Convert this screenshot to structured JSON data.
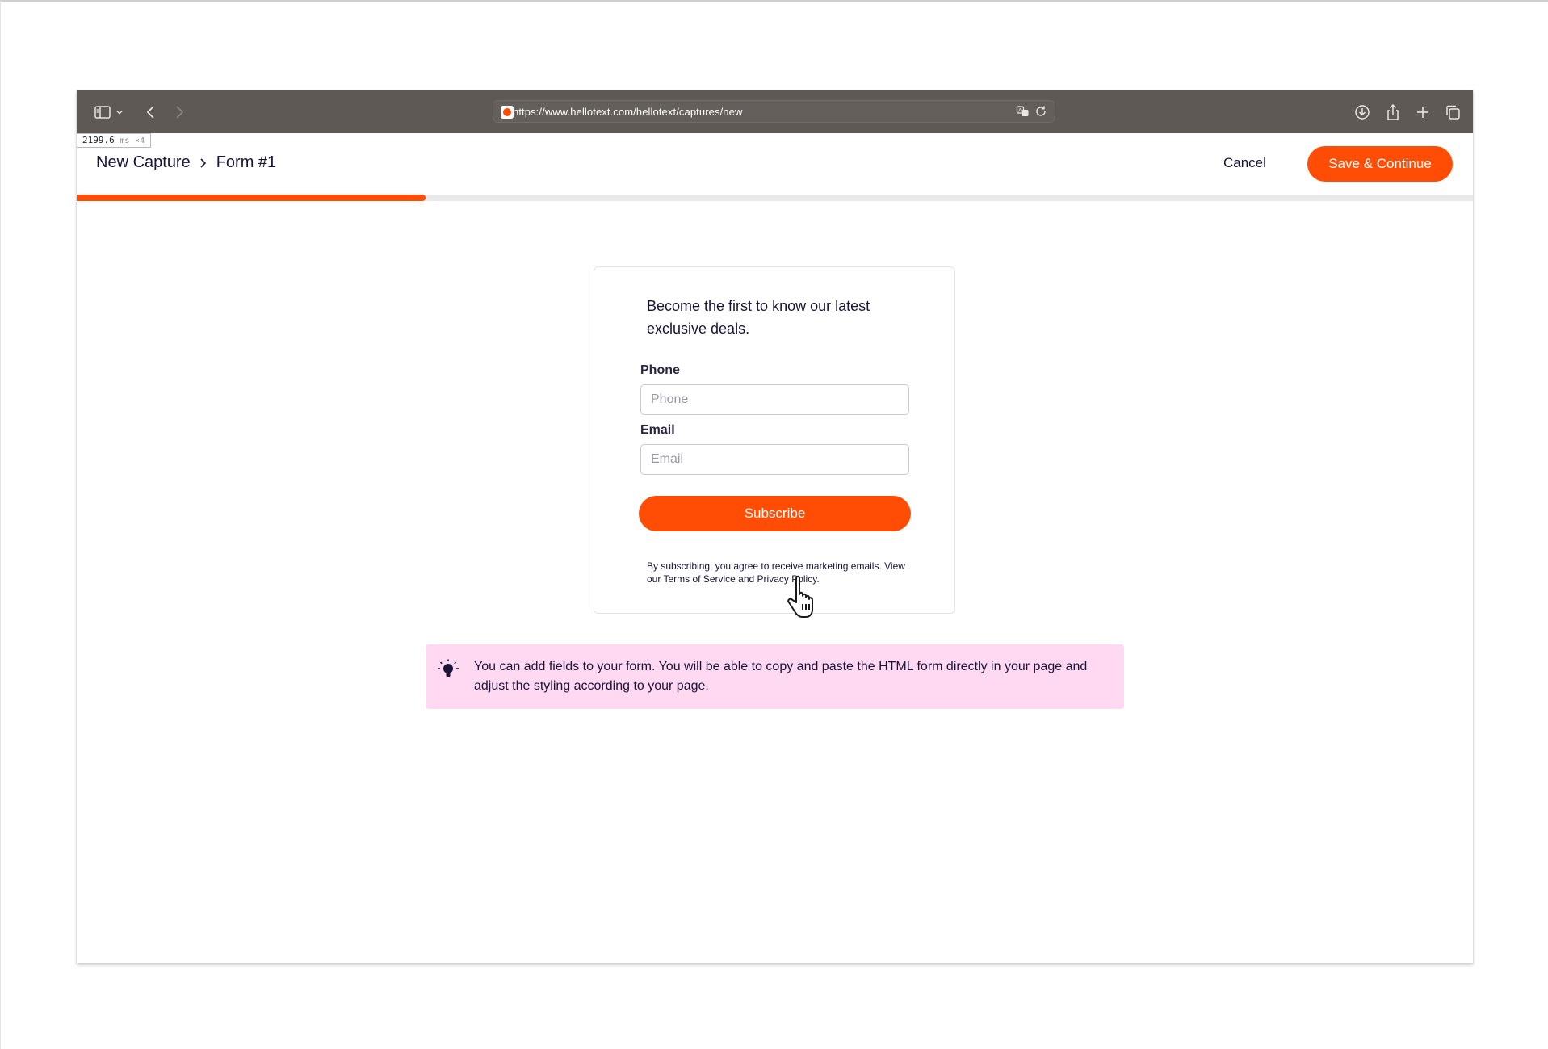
{
  "browser": {
    "url": "https://www.hellotext.com/hellotext/captures/new",
    "timing": {
      "value": "2199.6",
      "unit": "ms",
      "multiplier": "×4"
    }
  },
  "header": {
    "breadcrumb": [
      "New Capture",
      "Form #1"
    ],
    "cancel_label": "Cancel",
    "save_label": "Save & Continue"
  },
  "progress": {
    "fraction": 0.25
  },
  "form": {
    "heading": "Become the first to know our latest exclusive deals.",
    "fields": [
      {
        "label": "Phone",
        "placeholder": "Phone",
        "value": ""
      },
      {
        "label": "Email",
        "placeholder": "Email",
        "value": ""
      }
    ],
    "submit_label": "Subscribe",
    "legal": {
      "prefix": "By subscribing, you agree to receive marketing emails. View our ",
      "terms_link": "Terms of Service",
      "joiner": " and ",
      "privacy_link": "Privacy Policy",
      "suffix": "."
    }
  },
  "tip": {
    "icon": "lightbulb-icon",
    "text": "You can add fields to your form. You will be able to copy and paste the HTML form directly in your page and adjust the styling according to your page."
  },
  "colors": {
    "accent": "#ff4d05",
    "toolbar": "#5e5955",
    "tip_bg": "#ffd9f1",
    "text": "#1a1438"
  }
}
